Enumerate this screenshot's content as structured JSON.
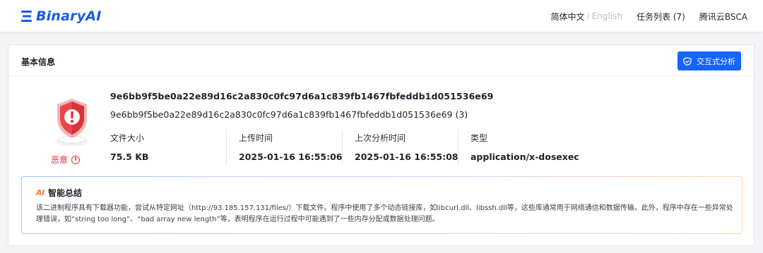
{
  "header": {
    "logo_text": "BinaryAI",
    "lang_current": "简体中文",
    "lang_separator": "/",
    "lang_other": "English",
    "task_list": "任务列表 (7)",
    "bsca": "腾讯云BSCA"
  },
  "card": {
    "title": "基本信息",
    "interactive_button": "交互式分析",
    "verdict": "恶意",
    "verdict_color": "#e2303a",
    "accent_color": "#1664ff",
    "sha256": "9e6bb9f5be0a22e89d16c2a830c0fc97d6a1c839fb1467fbfeddb1d051536e69",
    "file_name": "9e6bb9f5be0a22e89d16c2a830c0fc97d6a1c839fb1467fbfeddb1d051536e69 (3)",
    "meta": [
      {
        "label": "文件大小",
        "value": "75.5 KB"
      },
      {
        "label": "上传时间",
        "value": "2025-01-16 16:55:06"
      },
      {
        "label": "上次分析时间",
        "value": "2025-01-16 16:55:08"
      },
      {
        "label": "类型",
        "value": "application/x-dosexec"
      }
    ]
  },
  "summary": {
    "badge_prefix": "A",
    "badge_suffix": "I",
    "title": "智能总结",
    "text": "该二进制程序具有下载器功能，尝试从特定网址（http://93.185.157.131/files/）下载文件。程序中使用了多个动态链接库，如libcurl.dll、libssh.dll等，这些库通常用于网络通信和数据传输。此外，程序中存在一些异常处理错误，如“string too long”、“bad array new length”等，表明程序在运行过程中可能遇到了一些内存分配或数据处理问题。"
  },
  "icons": [
    "logo-icon",
    "shield-icon",
    "malicious-warning-icon",
    "info-icon",
    "ai-icon"
  ]
}
